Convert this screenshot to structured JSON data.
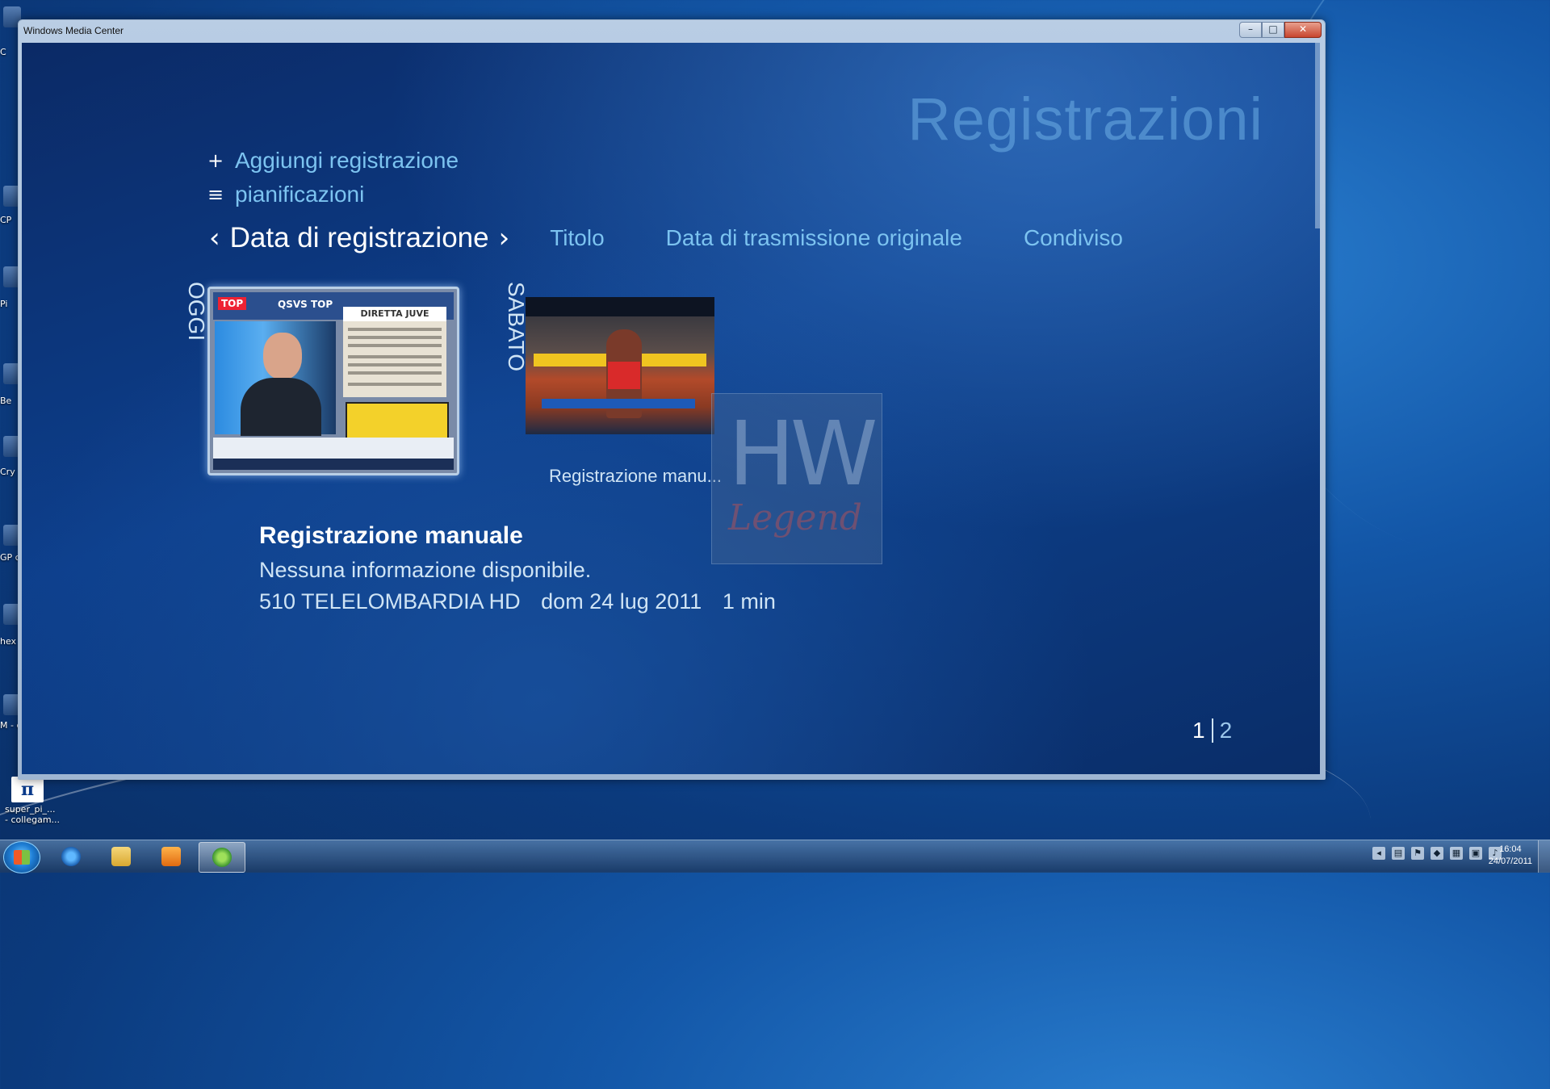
{
  "window": {
    "title": "Windows Media Center",
    "controls": {
      "minimize": "–",
      "maximize": "□",
      "close": "✕"
    }
  },
  "page_title": "Registrazioni",
  "menu": [
    {
      "icon": "plus-icon",
      "glyph": "+",
      "label": "Aggiungi registrazione"
    },
    {
      "icon": "list-icon",
      "glyph": "≡",
      "label": "pianificazioni"
    }
  ],
  "sort_tabs": {
    "prev_glyph": "‹",
    "next_glyph": "›",
    "active": "Data di registrazione",
    "others": [
      "Titolo",
      "Data di trasmissione originale",
      "Condiviso"
    ]
  },
  "groups": [
    {
      "label": "OGGI",
      "thumb": {
        "badge": "TOP",
        "program": "QSVS TOP",
        "newspaper_header": "DIRETTA JUVE"
      }
    },
    {
      "label": "SABATO",
      "caption": "Registrazione manu..."
    }
  ],
  "watermark": {
    "text_top": "HW",
    "text_bottom": "Legend"
  },
  "details": {
    "title": "Registrazione manuale",
    "description": "Nessuna informazione disponibile.",
    "channel": "510 TELELOMBARDIA HD",
    "date": "dom 24 lug 2011",
    "duration": "1 min"
  },
  "pager": {
    "current": "1",
    "total": "2"
  },
  "desktop": {
    "shortcut_label_1": "super_pi_...",
    "shortcut_label_2": "- collegam...",
    "partial_labels": [
      "C",
      "CP",
      "Pi",
      "Be",
      "Cry",
      "GP col",
      "hex col",
      "M - c"
    ]
  },
  "taskbar": {
    "clock_time": "16:04",
    "clock_date": "24/07/2011"
  }
}
